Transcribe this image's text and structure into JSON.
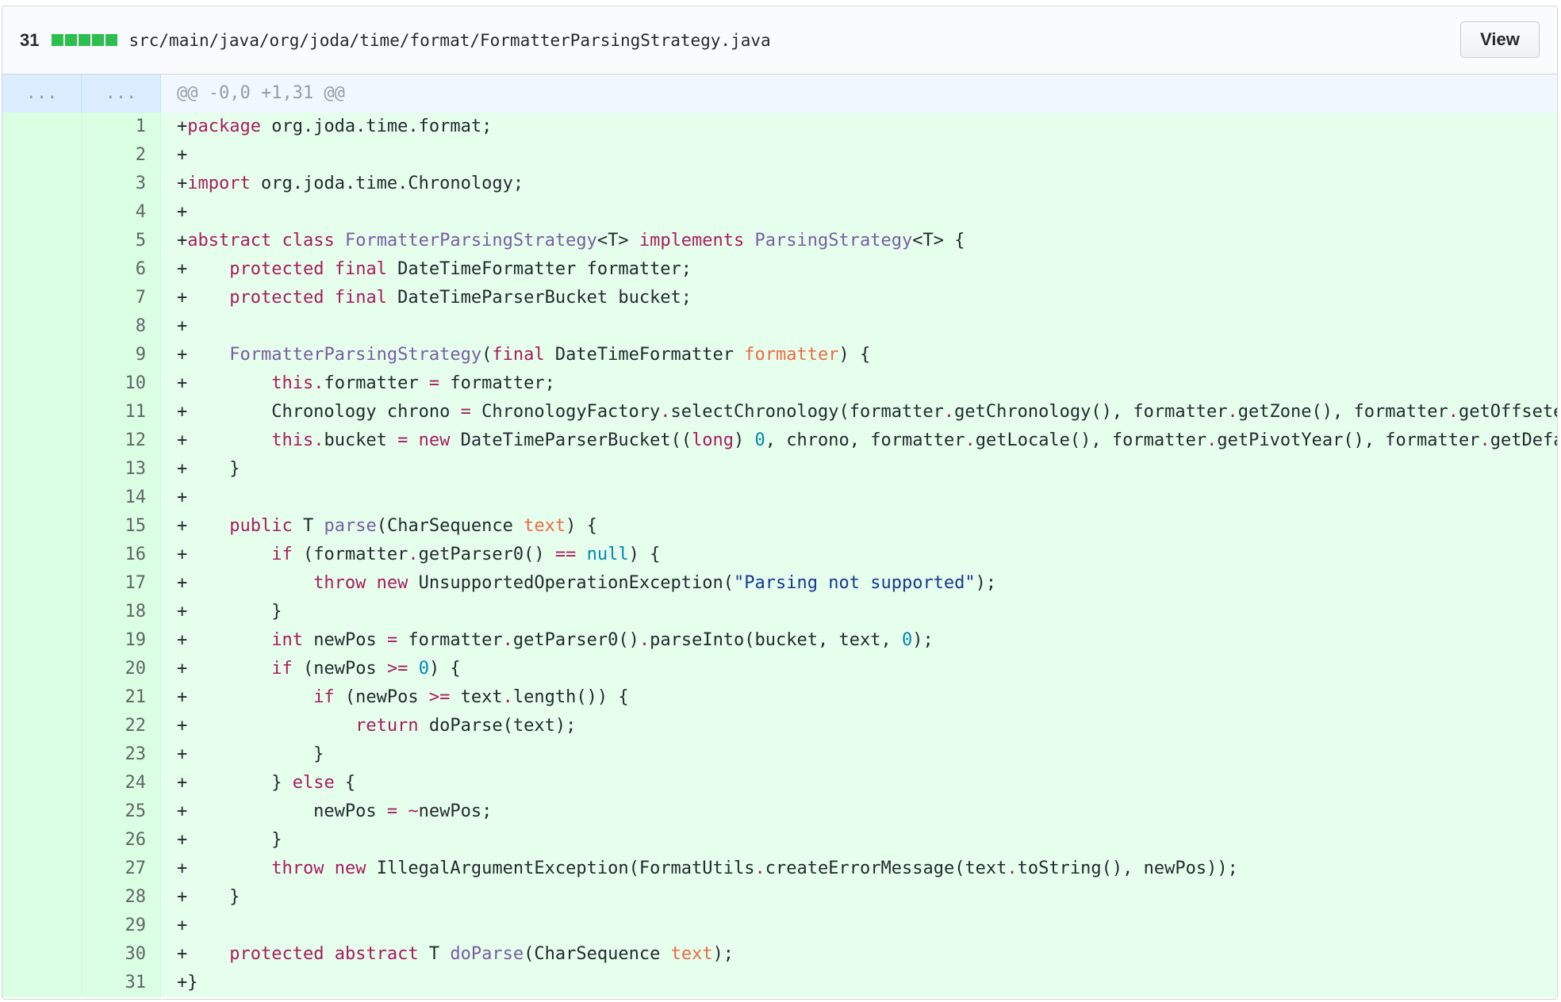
{
  "header": {
    "additions_count": "31",
    "file_path": "src/main/java/org/joda/time/format/FormatterParsingStrategy.java",
    "view_label": "View"
  },
  "hunk": {
    "old_num": "...",
    "new_num": "...",
    "text": "@@ -0,0 +1,31 @@"
  },
  "lines": [
    {
      "n": "1"
    },
    {
      "n": "2"
    },
    {
      "n": "3"
    },
    {
      "n": "4"
    },
    {
      "n": "5"
    },
    {
      "n": "6"
    },
    {
      "n": "7"
    },
    {
      "n": "8"
    },
    {
      "n": "9"
    },
    {
      "n": "10"
    },
    {
      "n": "11"
    },
    {
      "n": "12"
    },
    {
      "n": "13"
    },
    {
      "n": "14"
    },
    {
      "n": "15"
    },
    {
      "n": "16"
    },
    {
      "n": "17"
    },
    {
      "n": "18"
    },
    {
      "n": "19"
    },
    {
      "n": "20"
    },
    {
      "n": "21"
    },
    {
      "n": "22"
    },
    {
      "n": "23"
    },
    {
      "n": "24"
    },
    {
      "n": "25"
    },
    {
      "n": "26"
    },
    {
      "n": "27"
    },
    {
      "n": "28"
    },
    {
      "n": "29"
    },
    {
      "n": "30"
    },
    {
      "n": "31"
    }
  ],
  "code": [
    [
      [
        "",
        "+"
      ],
      [
        "k",
        "package"
      ],
      [
        "",
        " org.joda.time.format;"
      ]
    ],
    [
      [
        "",
        "+"
      ]
    ],
    [
      [
        "",
        "+"
      ],
      [
        "k",
        "import"
      ],
      [
        "",
        " org.joda.time.Chronology;"
      ]
    ],
    [
      [
        "",
        "+"
      ]
    ],
    [
      [
        "",
        "+"
      ],
      [
        "k",
        "abstract"
      ],
      [
        "",
        " "
      ],
      [
        "k",
        "class"
      ],
      [
        "",
        " "
      ],
      [
        "e",
        "FormatterParsingStrategy"
      ],
      [
        "",
        "<T> "
      ],
      [
        "k",
        "implements"
      ],
      [
        "",
        " "
      ],
      [
        "e",
        "ParsingStrategy"
      ],
      [
        "",
        "<T> {"
      ]
    ],
    [
      [
        "",
        "+    "
      ],
      [
        "k",
        "protected"
      ],
      [
        "",
        " "
      ],
      [
        "k",
        "final"
      ],
      [
        "",
        " DateTimeFormatter formatter;"
      ]
    ],
    [
      [
        "",
        "+    "
      ],
      [
        "k",
        "protected"
      ],
      [
        "",
        " "
      ],
      [
        "k",
        "final"
      ],
      [
        "",
        " DateTimeParserBucket bucket;"
      ]
    ],
    [
      [
        "",
        "+"
      ]
    ],
    [
      [
        "",
        "+    "
      ],
      [
        "e",
        "FormatterParsingStrategy"
      ],
      [
        "",
        "("
      ],
      [
        "k",
        "final"
      ],
      [
        "",
        " DateTimeFormatter "
      ],
      [
        "v",
        "formatter"
      ],
      [
        "",
        ") {"
      ]
    ],
    [
      [
        "",
        "+        "
      ],
      [
        "k",
        "this"
      ],
      [
        "o",
        "."
      ],
      [
        "",
        "formatter "
      ],
      [
        "o",
        "="
      ],
      [
        "",
        " formatter;"
      ]
    ],
    [
      [
        "",
        "+        Chronology chrono "
      ],
      [
        "o",
        "="
      ],
      [
        "",
        " ChronologyFactory"
      ],
      [
        "o",
        "."
      ],
      [
        "",
        "selectChronology(formatter"
      ],
      [
        "o",
        "."
      ],
      [
        "",
        "getChronology(), formatter"
      ],
      [
        "o",
        "."
      ],
      [
        "",
        "getZone(), formatter"
      ],
      [
        "o",
        "."
      ],
      [
        "",
        "getOffsetedChronology());"
      ]
    ],
    [
      [
        "",
        "+        "
      ],
      [
        "k",
        "this"
      ],
      [
        "o",
        "."
      ],
      [
        "",
        "bucket "
      ],
      [
        "o",
        "="
      ],
      [
        "",
        " "
      ],
      [
        "k",
        "new"
      ],
      [
        "",
        " DateTimeParserBucket(("
      ],
      [
        "k",
        "long"
      ],
      [
        "",
        ") "
      ],
      [
        "c",
        "0"
      ],
      [
        "",
        ", chrono, formatter"
      ],
      [
        "o",
        "."
      ],
      [
        "",
        "getLocale(), formatter"
      ],
      [
        "o",
        "."
      ],
      [
        "",
        "getPivotYear(), formatter"
      ],
      [
        "o",
        "."
      ],
      [
        "",
        "getDefaultYear());"
      ]
    ],
    [
      [
        "",
        "+    }"
      ]
    ],
    [
      [
        "",
        "+"
      ]
    ],
    [
      [
        "",
        "+    "
      ],
      [
        "k",
        "public"
      ],
      [
        "",
        " T "
      ],
      [
        "e",
        "parse"
      ],
      [
        "",
        "(CharSequence "
      ],
      [
        "v",
        "text"
      ],
      [
        "",
        ") {"
      ]
    ],
    [
      [
        "",
        "+        "
      ],
      [
        "k",
        "if"
      ],
      [
        "",
        " (formatter"
      ],
      [
        "o",
        "."
      ],
      [
        "",
        "getParser0() "
      ],
      [
        "o",
        "=="
      ],
      [
        "",
        " "
      ],
      [
        "c",
        "null"
      ],
      [
        "",
        ") {"
      ]
    ],
    [
      [
        "",
        "+            "
      ],
      [
        "k",
        "throw"
      ],
      [
        "",
        " "
      ],
      [
        "k",
        "new"
      ],
      [
        "",
        " UnsupportedOperationException("
      ],
      [
        "s",
        "\"Parsing not supported\""
      ],
      [
        "",
        ");"
      ]
    ],
    [
      [
        "",
        "+        }"
      ]
    ],
    [
      [
        "",
        "+        "
      ],
      [
        "k",
        "int"
      ],
      [
        "",
        " newPos "
      ],
      [
        "o",
        "="
      ],
      [
        "",
        " formatter"
      ],
      [
        "o",
        "."
      ],
      [
        "",
        "getParser0()"
      ],
      [
        "o",
        "."
      ],
      [
        "",
        "parseInto(bucket, text, "
      ],
      [
        "c",
        "0"
      ],
      [
        "",
        ");"
      ]
    ],
    [
      [
        "",
        "+        "
      ],
      [
        "k",
        "if"
      ],
      [
        "",
        " (newPos "
      ],
      [
        "o",
        ">="
      ],
      [
        "",
        " "
      ],
      [
        "c",
        "0"
      ],
      [
        "",
        ") {"
      ]
    ],
    [
      [
        "",
        "+            "
      ],
      [
        "k",
        "if"
      ],
      [
        "",
        " (newPos "
      ],
      [
        "o",
        ">="
      ],
      [
        "",
        " text"
      ],
      [
        "o",
        "."
      ],
      [
        "",
        "length()) {"
      ]
    ],
    [
      [
        "",
        "+                "
      ],
      [
        "k",
        "return"
      ],
      [
        "",
        " doParse(text);"
      ]
    ],
    [
      [
        "",
        "+            }"
      ]
    ],
    [
      [
        "",
        "+        } "
      ],
      [
        "k",
        "else"
      ],
      [
        "",
        " {"
      ]
    ],
    [
      [
        "",
        "+            newPos "
      ],
      [
        "o",
        "="
      ],
      [
        "",
        " "
      ],
      [
        "o",
        "~"
      ],
      [
        "",
        "newPos;"
      ]
    ],
    [
      [
        "",
        "+        }"
      ]
    ],
    [
      [
        "",
        "+        "
      ],
      [
        "k",
        "throw"
      ],
      [
        "",
        " "
      ],
      [
        "k",
        "new"
      ],
      [
        "",
        " IllegalArgumentException(FormatUtils"
      ],
      [
        "o",
        "."
      ],
      [
        "",
        "createErrorMessage(text"
      ],
      [
        "o",
        "."
      ],
      [
        "",
        "toString(), newPos));"
      ]
    ],
    [
      [
        "",
        "+    }"
      ]
    ],
    [
      [
        "",
        "+"
      ]
    ],
    [
      [
        "",
        "+    "
      ],
      [
        "k",
        "protected"
      ],
      [
        "",
        " "
      ],
      [
        "k",
        "abstract"
      ],
      [
        "",
        " T "
      ],
      [
        "e",
        "doParse"
      ],
      [
        "",
        "(CharSequence "
      ],
      [
        "v",
        "text"
      ],
      [
        "",
        ");"
      ]
    ],
    [
      [
        "",
        "+}"
      ]
    ]
  ],
  "colors": {
    "addition_bg": "#e6ffed",
    "addition_num_bg": "#cdffd8",
    "hunk_bg": "#f1f8ff",
    "diffstat_green": "#2cbe4e",
    "keyword": "#a71d5d",
    "entity": "#795da3",
    "variable": "#ed6a43",
    "constant": "#0086b3",
    "string": "#183691"
  }
}
